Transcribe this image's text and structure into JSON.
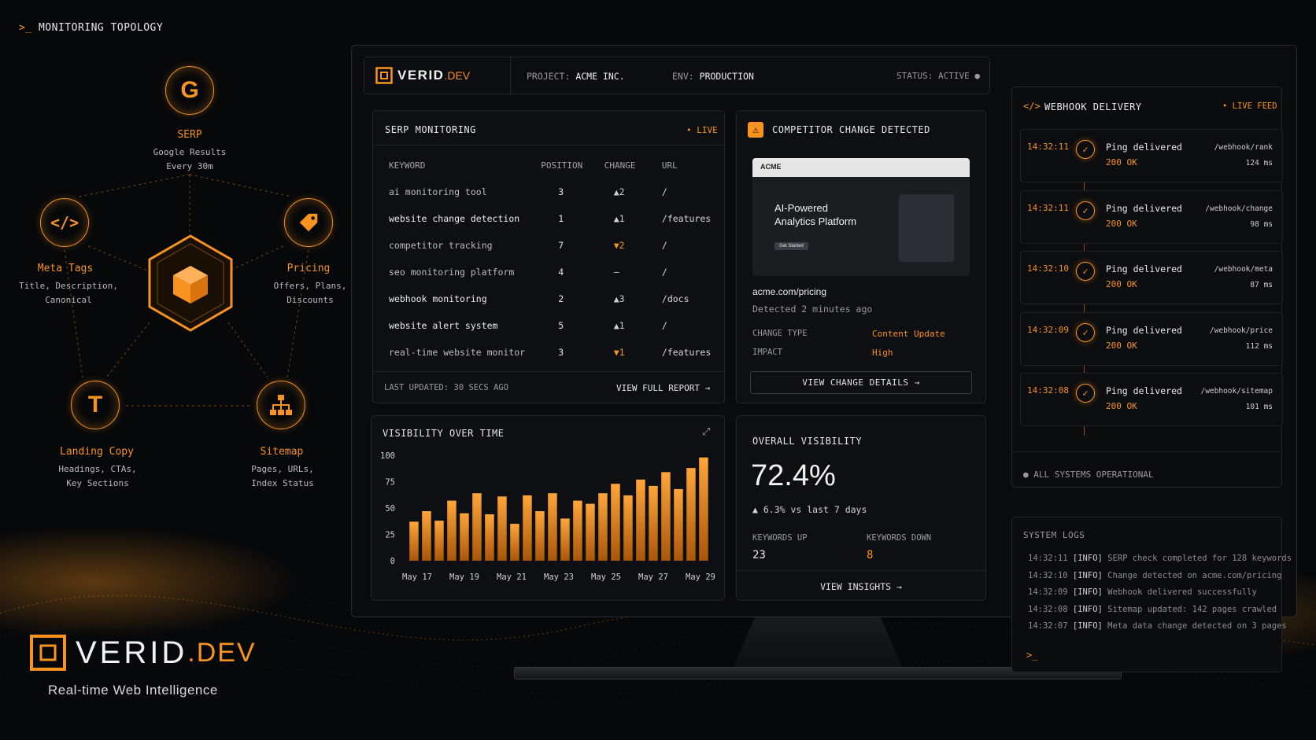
{
  "topology": {
    "header": "MONITORING TOPOLOGY",
    "nodes": {
      "serp": {
        "title": "SERP",
        "line1": "Google Results",
        "line2": "Every 30m"
      },
      "meta": {
        "title": "Meta Tags",
        "line1": "Title, Description,",
        "line2": "Canonical"
      },
      "pricing": {
        "title": "Pricing",
        "line1": "Offers, Plans,",
        "line2": "Discounts"
      },
      "landing": {
        "title": "Landing Copy",
        "line1": "Headings, CTAs,",
        "line2": "Key Sections"
      },
      "sitemap": {
        "title": "Sitemap",
        "line1": "Pages, URLs,",
        "line2": "Index Status"
      }
    }
  },
  "brand": {
    "name": "VERID",
    "tld": ".DEV",
    "tagline": "Real-time Web Intelligence"
  },
  "header": {
    "logo_name": "VERID",
    "logo_tld": ".DEV",
    "project_label": "PROJECT:",
    "project_value": "ACME INC.",
    "env_label": "ENV:",
    "env_value": "PRODUCTION",
    "status": "STATUS: ACTIVE"
  },
  "serp": {
    "title": "SERP MONITORING",
    "live": "• LIVE",
    "columns": [
      "KEYWORD",
      "POSITION",
      "CHANGE",
      "URL"
    ],
    "rows": [
      {
        "keyword": "ai monitoring tool",
        "position": "3",
        "change": "▲2",
        "dir": "up",
        "url": "/"
      },
      {
        "keyword": "website change detection",
        "position": "1",
        "change": "▲1",
        "dir": "up",
        "url": "/features"
      },
      {
        "keyword": "competitor tracking",
        "position": "7",
        "change": "▼2",
        "dir": "down",
        "url": "/"
      },
      {
        "keyword": "seo monitoring platform",
        "position": "4",
        "change": "—",
        "dir": "flat",
        "url": "/"
      },
      {
        "keyword": "webhook monitoring",
        "position": "2",
        "change": "▲3",
        "dir": "up",
        "url": "/docs"
      },
      {
        "keyword": "website alert system",
        "position": "5",
        "change": "▲1",
        "dir": "up",
        "url": "/"
      },
      {
        "keyword": "real-time website monitor",
        "position": "3",
        "change": "▼1",
        "dir": "down",
        "url": "/features"
      }
    ],
    "last_updated": "LAST UPDATED: 30 SECS AGO",
    "view_report": "VIEW FULL REPORT →"
  },
  "competitor": {
    "title": "COMPETITOR CHANGE DETECTED",
    "preview_brand": "ACME",
    "preview_headline_1": "AI-Powered",
    "preview_headline_2": "Analytics Platform",
    "preview_cta": "Get Started",
    "url": "acme.com/pricing",
    "detected": "Detected 2 minutes ago",
    "change_type_label": "CHANGE TYPE",
    "change_type_value": "Content Update",
    "impact_label": "IMPACT",
    "impact_value": "High",
    "button": "VIEW CHANGE DETAILS →"
  },
  "visibility_chart": {
    "title": "VISIBILITY OVER TIME"
  },
  "chart_data": {
    "type": "bar",
    "title": "VISIBILITY OVER TIME",
    "xlabel": "",
    "ylabel": "",
    "ylim": [
      0,
      100
    ],
    "yticks": [
      0,
      25,
      50,
      75,
      100
    ],
    "xtick_labels": [
      "May 17",
      "May 19",
      "May 21",
      "May 23",
      "May 25",
      "May 27",
      "May 29"
    ],
    "series": [
      {
        "values": [
          37,
          47,
          38,
          57,
          45,
          64,
          44,
          61,
          35,
          62,
          47,
          64,
          40,
          57,
          54,
          64,
          73,
          62,
          77,
          71,
          84,
          68,
          88,
          98
        ]
      }
    ],
    "grid": false
  },
  "overall": {
    "title": "OVERALL VISIBILITY",
    "value": "72.4%",
    "delta": "▲ 6.3% vs last 7 days",
    "kw_up_label": "KEYWORDS UP",
    "kw_up_value": "23",
    "kw_down_label": "KEYWORDS DOWN",
    "kw_down_value": "8",
    "button": "VIEW INSIGHTS →"
  },
  "webhook": {
    "title": "WEBHOOK DELIVERY",
    "live": "• LIVE FEED",
    "items": [
      {
        "time": "14:32:11",
        "label": "Ping delivered",
        "status": "200 OK",
        "path": "/webhook/rank",
        "ms": "124 ms"
      },
      {
        "time": "14:32:11",
        "label": "Ping delivered",
        "status": "200 OK",
        "path": "/webhook/change",
        "ms": "98 ms"
      },
      {
        "time": "14:32:10",
        "label": "Ping delivered",
        "status": "200 OK",
        "path": "/webhook/meta",
        "ms": "87 ms"
      },
      {
        "time": "14:32:09",
        "label": "Ping delivered",
        "status": "200 OK",
        "path": "/webhook/price",
        "ms": "112 ms"
      },
      {
        "time": "14:32:08",
        "label": "Ping delivered",
        "status": "200 OK",
        "path": "/webhook/sitemap",
        "ms": "101 ms"
      }
    ],
    "footer": "ALL SYSTEMS OPERATIONAL"
  },
  "logs": {
    "title": "SYSTEM LOGS",
    "lines": [
      {
        "time": "14:32:11",
        "level": "[INFO]",
        "msg": "SERP check completed for 128 keywords"
      },
      {
        "time": "14:32:10",
        "level": "[INFO]",
        "msg": "Change detected on acme.com/pricing"
      },
      {
        "time": "14:32:09",
        "level": "[INFO]",
        "msg": "Webhook delivered successfully"
      },
      {
        "time": "14:32:08",
        "level": "[INFO]",
        "msg": "Sitemap updated: 142 pages crawled"
      },
      {
        "time": "14:32:07",
        "level": "[INFO]",
        "msg": "Meta data change detected on 3 pages"
      }
    ],
    "prompt": ">_"
  },
  "colors": {
    "accent": "#f7931e",
    "bg": "#07080a",
    "panel": "#0e0f12",
    "text": "#d6d6d6",
    "muted": "#9a9a9a"
  },
  "icons": {
    "serp": "google-g-icon",
    "meta": "code-icon",
    "pricing": "price-tag-icon",
    "landing": "text-t-icon",
    "sitemap": "sitemap-icon",
    "center": "cube-icon"
  }
}
